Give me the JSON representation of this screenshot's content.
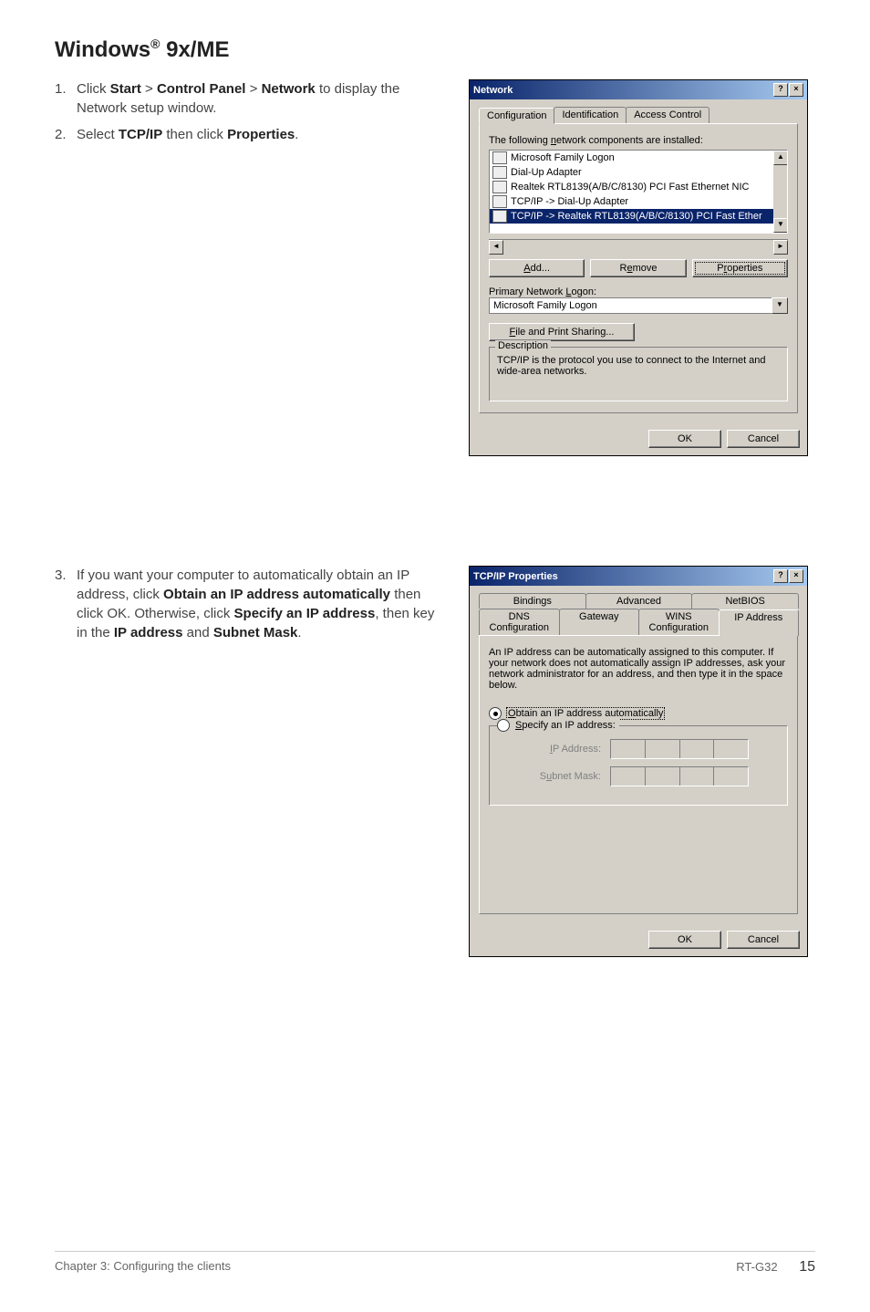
{
  "heading_prefix": "Windows",
  "heading_suffix": " 9x/ME",
  "steps_a": [
    {
      "num": "1.",
      "parts": [
        "Click ",
        {
          "b": "Start"
        },
        " > ",
        {
          "b": "Control Panel"
        },
        " > ",
        {
          "b": "Network"
        },
        " to display the Network setup window."
      ]
    },
    {
      "num": "2.",
      "parts": [
        "Select ",
        {
          "b": "TCP/IP"
        },
        " then click ",
        {
          "b": "Properties"
        },
        "."
      ]
    }
  ],
  "steps_b": [
    {
      "num": "3.",
      "parts": [
        "If you want your computer to automatically obtain an IP address, click ",
        {
          "b": "Obtain an IP address automatically"
        },
        " then click OK. Otherwise, click ",
        {
          "b": "Specify an IP address"
        },
        ", then key in the ",
        {
          "b": "IP address"
        },
        " and ",
        {
          "b": "Subnet Mask"
        },
        "."
      ]
    }
  ],
  "dialog1": {
    "title": "Network",
    "tabs": [
      "Configuration",
      "Identification",
      "Access Control"
    ],
    "list_label_pre": "The following ",
    "list_label_u": "n",
    "list_label_post": "etwork components are installed:",
    "items": [
      "Microsoft Family Logon",
      "Dial-Up Adapter",
      "Realtek RTL8139(A/B/C/8130) PCI Fast Ethernet NIC",
      "TCP/IP -> Dial-Up Adapter",
      "TCP/IP -> Realtek RTL8139(A/B/C/8130) PCI Fast Ether"
    ],
    "btn_add": "Add...",
    "btn_remove": "Remove",
    "btn_properties": "Properties",
    "primary_logon_label": "Primary Network Logon:",
    "primary_logon_value": "Microsoft Family Logon",
    "fps_btn": "File and Print Sharing...",
    "desc_legend": "Description",
    "desc_text": "TCP/IP is the protocol you use to connect to the Internet and wide-area networks.",
    "ok": "OK",
    "cancel": "Cancel"
  },
  "dialog2": {
    "title": "TCP/IP Properties",
    "tabs_row1": [
      "Bindings",
      "Advanced",
      "NetBIOS"
    ],
    "tabs_row2": [
      "DNS Configuration",
      "Gateway",
      "WINS Configuration",
      "IP Address"
    ],
    "intro": "An IP address can be automatically assigned to this computer. If your network does not automatically assign IP addresses, ask your network administrator for an address, and then type it in the space below.",
    "radio_auto_pre": "O",
    "radio_auto_post": "btain an IP address automatically",
    "radio_spec_pre": "S",
    "radio_spec_post": "pecify an IP address:",
    "ip_label": "IP Address:",
    "mask_label": "Subnet Mask:",
    "ok": "OK",
    "cancel": "Cancel"
  },
  "footer": {
    "left": "Chapter 3: Configuring the clients",
    "model": "RT-G32",
    "page": "15"
  },
  "icons": {
    "help": "?",
    "close": "×",
    "up": "▲",
    "down": "▼",
    "left": "◄",
    "right": "►",
    "dropdown": "▼"
  }
}
